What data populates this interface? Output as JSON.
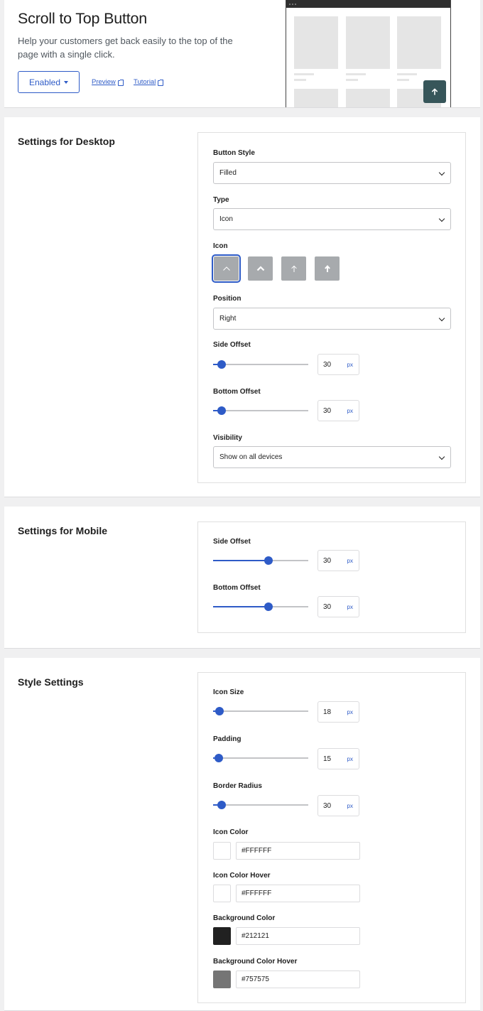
{
  "hero": {
    "title": "Scroll to Top Button",
    "description": "Help your customers get back easily to the top of the page with a single click.",
    "status_button": "Enabled",
    "preview_link": "Preview",
    "tutorial_link": "Tutorial"
  },
  "desktop": {
    "title": "Settings for Desktop",
    "button_style": {
      "label": "Button Style",
      "value": "Filled"
    },
    "type": {
      "label": "Type",
      "value": "Icon"
    },
    "icon": {
      "label": "Icon",
      "selected_index": 0,
      "options": [
        "caret-up-thin-icon",
        "caret-up-bold-icon",
        "arrow-up-thin-icon",
        "arrow-up-bold-icon"
      ]
    },
    "position": {
      "label": "Position",
      "value": "Right"
    },
    "side_offset": {
      "label": "Side Offset",
      "value": "30",
      "unit": "px",
      "fraction": 0.09
    },
    "bottom_offset": {
      "label": "Bottom Offset",
      "value": "30",
      "unit": "px",
      "fraction": 0.09
    },
    "visibility": {
      "label": "Visibility",
      "value": "Show on all devices"
    }
  },
  "mobile": {
    "title": "Settings for Mobile",
    "side_offset": {
      "label": "Side Offset",
      "value": "30",
      "unit": "px",
      "fraction": 0.58
    },
    "bottom_offset": {
      "label": "Bottom Offset",
      "value": "30",
      "unit": "px",
      "fraction": 0.58
    }
  },
  "style": {
    "title": "Style Settings",
    "icon_size": {
      "label": "Icon Size",
      "value": "18",
      "unit": "px",
      "fraction": 0.07
    },
    "padding": {
      "label": "Padding",
      "value": "15",
      "unit": "px",
      "fraction": 0.06
    },
    "border_radius": {
      "label": "Border Radius",
      "value": "30",
      "unit": "px",
      "fraction": 0.09
    },
    "icon_color": {
      "label": "Icon Color",
      "value": "#FFFFFF",
      "swatch": "#ffffff"
    },
    "icon_color_hover": {
      "label": "Icon Color Hover",
      "value": "#FFFFFF",
      "swatch": "#ffffff"
    },
    "background_color": {
      "label": "Background Color",
      "value": "#212121",
      "swatch": "#212121"
    },
    "background_color_hover": {
      "label": "Background Color Hover",
      "value": "#757575",
      "swatch": "#757575"
    }
  },
  "colors": {
    "accent": "#2e5bc7",
    "preview_button": "#37565a"
  }
}
